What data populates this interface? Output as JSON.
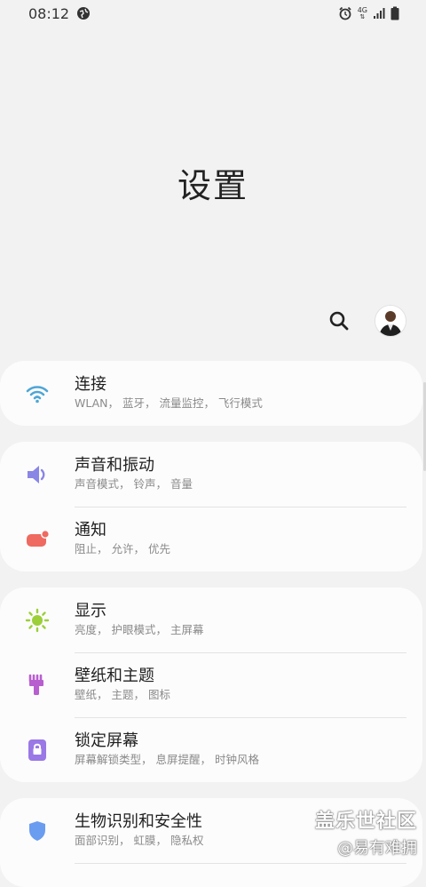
{
  "status_bar": {
    "time": "08:12",
    "network_type": "4G",
    "icons": [
      "globe-icon",
      "alarm-icon",
      "network-4g-icon",
      "signal-icon",
      "battery-icon"
    ]
  },
  "header": {
    "title": "设置"
  },
  "toolbar": {
    "icons": [
      "search-icon",
      "avatar"
    ]
  },
  "cards": [
    {
      "items": [
        {
          "title": "连接",
          "subtitle": "WLAN， 蓝牙， 流量监控， 飞行模式",
          "icon": "wifi-icon",
          "color": "#4fa5d6"
        }
      ]
    },
    {
      "items": [
        {
          "title": "声音和振动",
          "subtitle": "声音模式， 铃声， 音量",
          "icon": "volume-icon",
          "color": "#8a86e6"
        },
        {
          "title": "通知",
          "subtitle": "阻止， 允许， 优先",
          "icon": "notification-icon",
          "color": "#ef6a60"
        }
      ]
    },
    {
      "items": [
        {
          "title": "显示",
          "subtitle": "亮度， 护眼模式， 主屏幕",
          "icon": "brightness-icon",
          "color": "#9ccf3a"
        },
        {
          "title": "壁纸和主题",
          "subtitle": "壁纸， 主题， 图标",
          "icon": "paintbrush-icon",
          "color": "#b85fd0"
        },
        {
          "title": "锁定屏幕",
          "subtitle": "屏幕解锁类型， 息屏提醒， 时钟风格",
          "icon": "lock-icon",
          "color": "#9a78e6"
        }
      ]
    },
    {
      "items": [
        {
          "title": "生物识别和安全性",
          "subtitle": "面部识别， 虹膜， 隐私权",
          "icon": "shield-icon",
          "color": "#6a9cf0"
        }
      ]
    }
  ],
  "watermark": {
    "line1": "盖乐世社区",
    "line2": "@易有难拥"
  }
}
